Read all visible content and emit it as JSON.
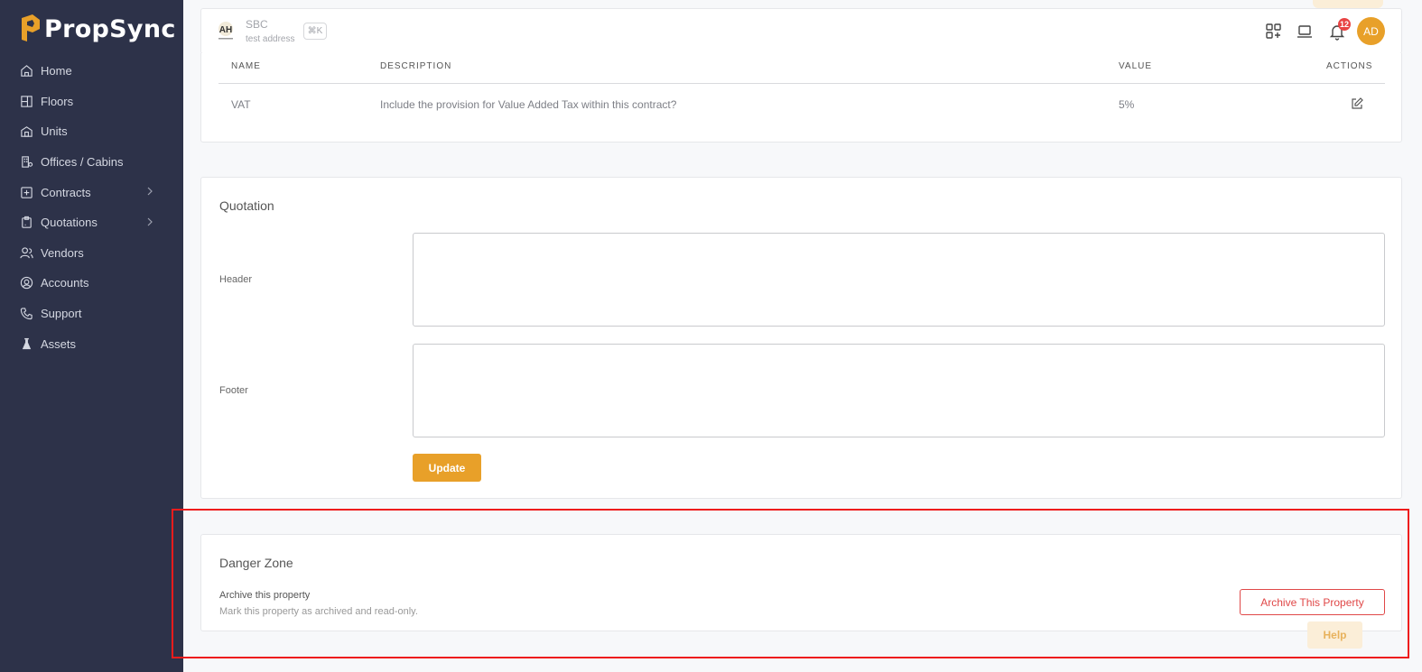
{
  "app": {
    "name": "PropSync"
  },
  "sidebar": {
    "items": [
      {
        "label": "Home",
        "icon": "home-icon",
        "has_children": false
      },
      {
        "label": "Floors",
        "icon": "floors-icon",
        "has_children": false
      },
      {
        "label": "Units",
        "icon": "units-icon",
        "has_children": false
      },
      {
        "label": "Offices / Cabins",
        "icon": "building-icon",
        "has_children": false
      },
      {
        "label": "Contracts",
        "icon": "contract-icon",
        "has_children": true
      },
      {
        "label": "Quotations",
        "icon": "clipboard-icon",
        "has_children": true
      },
      {
        "label": "Vendors",
        "icon": "users-icon",
        "has_children": false
      },
      {
        "label": "Accounts",
        "icon": "account-icon",
        "has_children": false
      },
      {
        "label": "Support",
        "icon": "phone-icon",
        "has_children": false
      },
      {
        "label": "Assets",
        "icon": "flask-icon",
        "has_children": false
      }
    ]
  },
  "header": {
    "company_name": "SBC",
    "company_address": "test address",
    "shortcut": "⌘K",
    "notification_count": "12",
    "avatar_initials": "AD"
  },
  "settings_table": {
    "columns": [
      "NAME",
      "DESCRIPTION",
      "VALUE",
      "ACTIONS"
    ],
    "rows": [
      {
        "name": "VAT",
        "description": "Include the provision for Value Added Tax within this contract?",
        "value": "5%"
      }
    ]
  },
  "quotation": {
    "title": "Quotation",
    "header_label": "Header",
    "header_value": "",
    "footer_label": "Footer",
    "footer_value": "",
    "update_label": "Update"
  },
  "danger_zone": {
    "title": "Danger Zone",
    "archive_title": "Archive this property",
    "archive_description": "Mark this property as archived and read-only.",
    "archive_button": "Archive This Property"
  },
  "help": {
    "label": "Help"
  },
  "colors": {
    "sidebar_bg": "#2d3249",
    "accent": "#e8a029",
    "danger": "#e04848",
    "highlight": "#ee1c1c"
  }
}
